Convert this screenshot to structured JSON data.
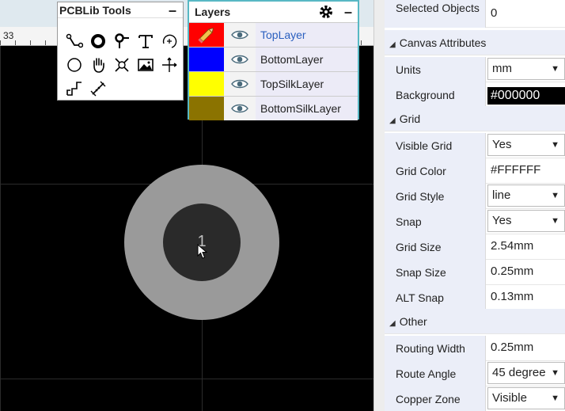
{
  "canvas": {
    "ruler_label": "33",
    "pad_number": "1"
  },
  "tools": {
    "title": "PCBLib Tools",
    "minimize": "–",
    "icons": [
      "track-icon",
      "pad-icon",
      "via-icon",
      "text-icon",
      "arc-icon",
      "circle-icon",
      "pan-hand-icon",
      "measure-icon",
      "image-icon",
      "move-icon",
      "polyline-icon",
      "dimension-icon"
    ]
  },
  "layers": {
    "title": "Layers",
    "minimize": "–",
    "items": [
      {
        "name": "TopLayer",
        "color": "#FF0000"
      },
      {
        "name": "BottomLayer",
        "color": "#0000FF"
      },
      {
        "name": "TopSilkLayer",
        "color": "#FFFF00"
      },
      {
        "name": "BottomSilkLayer",
        "color": "#8B7300"
      }
    ]
  },
  "properties": {
    "selected_objects_label": "Selected Objects",
    "selected_objects_value": "0",
    "canvas_section": "Canvas Attributes",
    "units_label": "Units",
    "units_value": "mm",
    "background_label": "Background",
    "background_value": "#000000",
    "grid_section": "Grid",
    "visible_grid_label": "Visible Grid",
    "visible_grid_value": "Yes",
    "grid_color_label": "Grid Color",
    "grid_color_value": "#FFFFFF",
    "grid_style_label": "Grid Style",
    "grid_style_value": "line",
    "snap_label": "Snap",
    "snap_value": "Yes",
    "grid_size_label": "Grid Size",
    "grid_size_value": "2.54mm",
    "snap_size_label": "Snap Size",
    "snap_size_value": "0.25mm",
    "alt_snap_label": "ALT Snap",
    "alt_snap_value": "0.13mm",
    "other_section": "Other",
    "routing_width_label": "Routing Width",
    "routing_width_value": "0.25mm",
    "route_angle_label": "Route Angle",
    "route_angle_value": "45 degree",
    "copper_zone_label": "Copper Zone",
    "copper_zone_value": "Visible"
  }
}
